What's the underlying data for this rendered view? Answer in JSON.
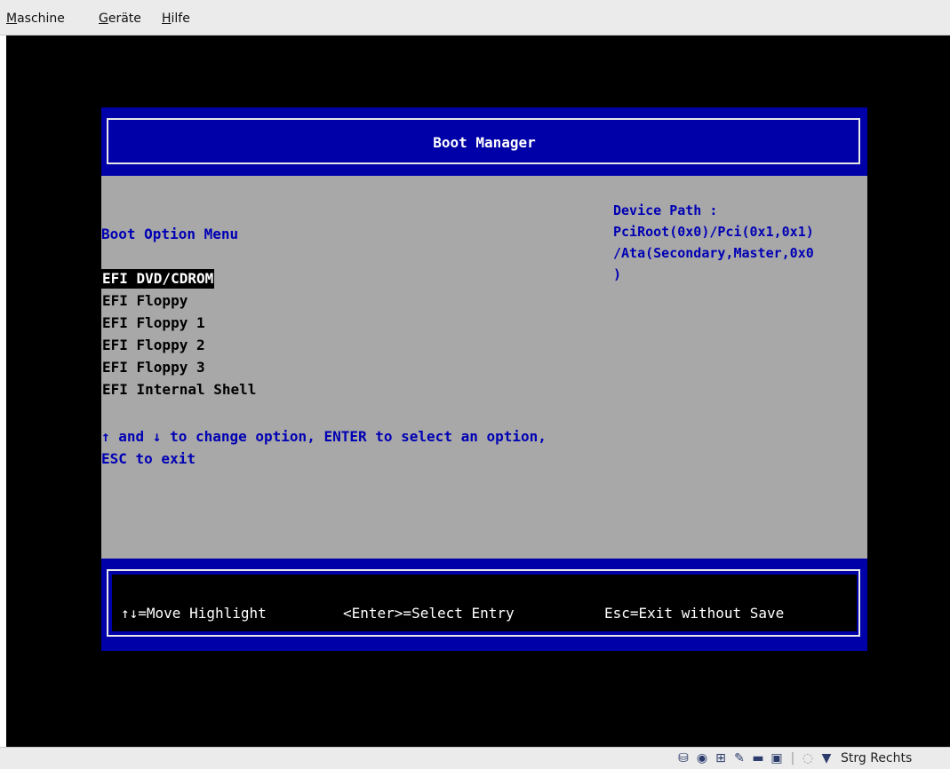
{
  "menubar": {
    "items": [
      {
        "label": "Maschine",
        "accel": "M",
        "rest": "aschine"
      },
      {
        "label": "Geräte",
        "accel": "G",
        "rest": "eräte"
      },
      {
        "label": "Hilfe",
        "accel": "H",
        "rest": "ilfe"
      }
    ]
  },
  "efi": {
    "title": "Boot Manager",
    "menu_title": "Boot Option Menu",
    "options": [
      {
        "label": "EFI DVD/CDROM",
        "selected": true
      },
      {
        "label": "EFI Floppy",
        "selected": false
      },
      {
        "label": "EFI Floppy 1",
        "selected": false
      },
      {
        "label": "EFI Floppy 2",
        "selected": false
      },
      {
        "label": "EFI Floppy 3",
        "selected": false
      },
      {
        "label": "EFI Internal Shell",
        "selected": false
      }
    ],
    "help": [
      "↑ and ↓ to change option, ENTER to select an option,",
      "ESC to exit"
    ],
    "device_path": [
      "Device Path :",
      "PciRoot(0x0)/Pci(0x1,0x1)",
      "/Ata(Secondary,Master,0x0",
      ")"
    ],
    "footer": {
      "move": "↑↓=Move Highlight",
      "select": "<Enter>=Select Entry",
      "exit": "Esc=Exit without Save"
    }
  },
  "statusbar": {
    "icons": [
      "hard-disk-icon",
      "optical-drive-icon",
      "network-icon",
      "usb-icon",
      "shared-folder-icon",
      "display-icon",
      "mouse-integration-icon",
      "host-key-icon"
    ],
    "host_key": "Strg Rechts"
  },
  "colors": {
    "efi_blue": "#0000a8",
    "efi_gray": "#a8a8a8",
    "text_blue": "#0000b4"
  }
}
